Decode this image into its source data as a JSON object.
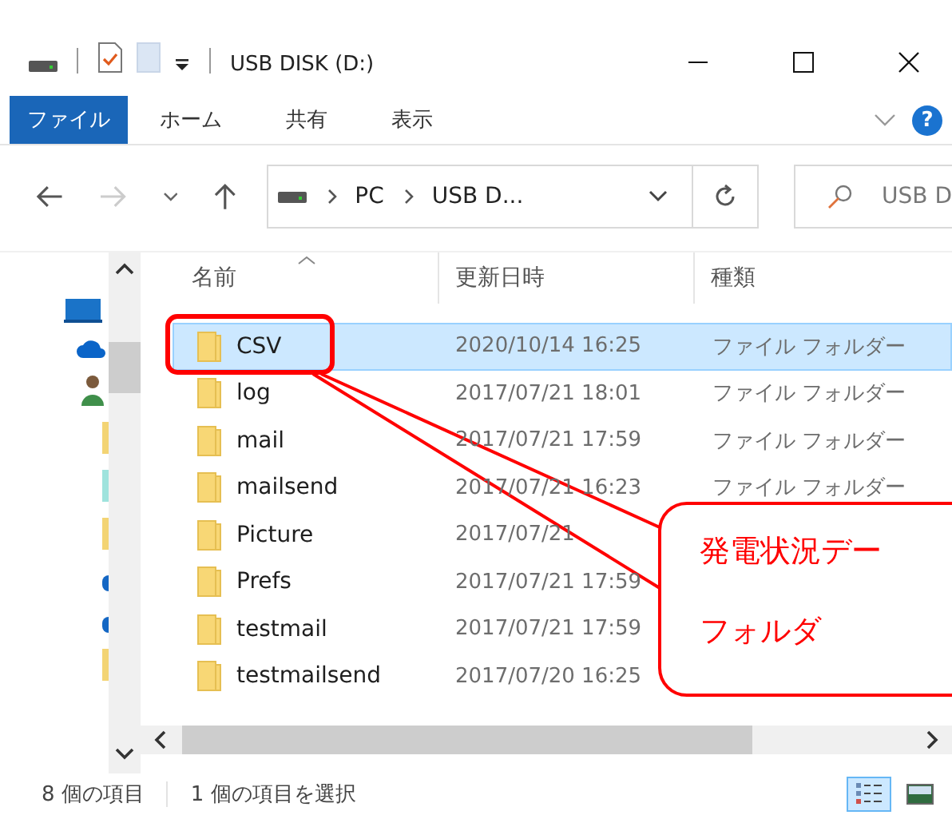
{
  "window": {
    "title": "USB DISK (D:)"
  },
  "ribbon": {
    "file_tab": "ファイル",
    "tabs": [
      {
        "label": "ホーム",
        "selected": false
      },
      {
        "label": "共有",
        "selected": false
      },
      {
        "label": "表示",
        "selected": false
      }
    ],
    "help": "?"
  },
  "address": {
    "crumbs": [
      "PC",
      "USB D..."
    ],
    "search_placeholder": "USB D"
  },
  "columns": [
    {
      "label": "名前",
      "sorted": true
    },
    {
      "label": "更新日時",
      "sorted": false
    },
    {
      "label": "種類",
      "sorted": false
    }
  ],
  "rows": [
    {
      "name": "CSV",
      "date": "2020/10/14 16:25",
      "type": "ファイル フォルダー",
      "selected": true
    },
    {
      "name": "log",
      "date": "2017/07/21 18:01",
      "type": "ファイル フォルダー",
      "selected": false
    },
    {
      "name": "mail",
      "date": "2017/07/21 17:59",
      "type": "ファイル フォルダー",
      "selected": false
    },
    {
      "name": "mailsend",
      "date": "2017/07/21 16:23",
      "type": "ファイル フォルダー",
      "selected": false
    },
    {
      "name": "Picture",
      "date": "2017/07/21",
      "selected": false
    },
    {
      "name": "Prefs",
      "date": "2017/07/21 17:59",
      "selected": false
    },
    {
      "name": "testmail",
      "date": "2017/07/21 17:59",
      "selected": false
    },
    {
      "name": "testmailsend",
      "date": "2017/07/20 16:25",
      "selected": false
    }
  ],
  "status_bar": {
    "count": "8 個の項目",
    "selection": "1 個の項目を選択",
    "views": [
      {
        "kind": "details",
        "selected": true
      },
      {
        "kind": "tiles",
        "selected": false
      }
    ]
  },
  "callout": {
    "lines": [
      "発電状況デー",
      "フォルダ"
    ]
  }
}
